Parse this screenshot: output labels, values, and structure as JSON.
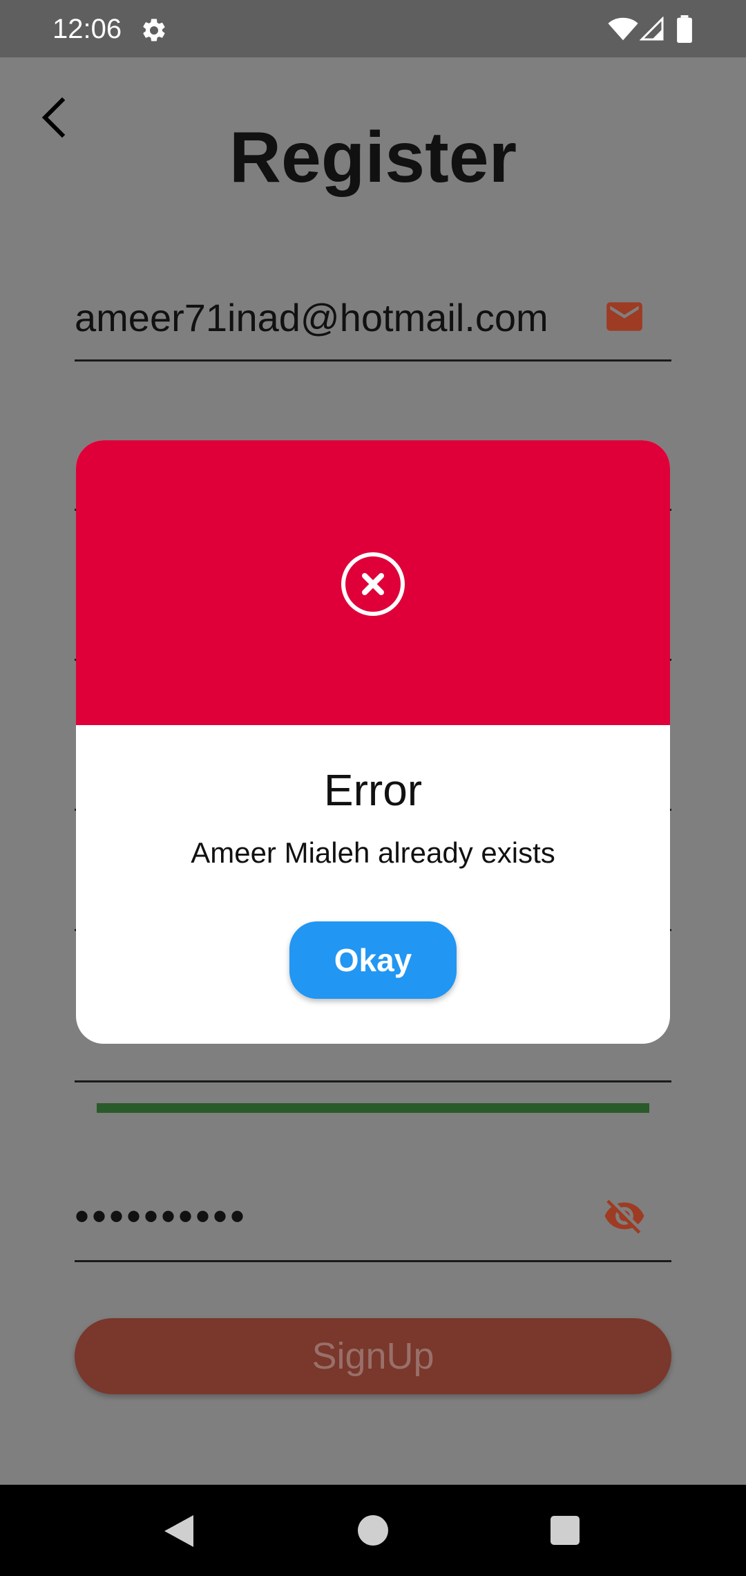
{
  "status_bar": {
    "time": "12:06"
  },
  "screen": {
    "title": "Register"
  },
  "form": {
    "email_value": "ameer71inad@hotmail.com",
    "password_value": "••••••••••",
    "signup_label": "SignUp"
  },
  "dialog": {
    "title": "Error",
    "message": "Ameer Mialeh already exists",
    "okay_label": "Okay"
  },
  "colors": {
    "dialog_header": "#df0039",
    "okay_button": "#2196f3",
    "signup_button": "#7a372b",
    "accent_icon": "#9e3b23",
    "strength_bar": "#2a5a2a"
  },
  "icons": {
    "status": [
      "gear-icon",
      "wifi-icon",
      "signal-icon",
      "battery-icon"
    ],
    "email_field": "mail-icon",
    "password_field": "visibility-off-icon",
    "dialog": "error-circle-x-icon",
    "navigation": [
      "nav-back-icon",
      "nav-home-icon",
      "nav-recents-icon"
    ]
  }
}
